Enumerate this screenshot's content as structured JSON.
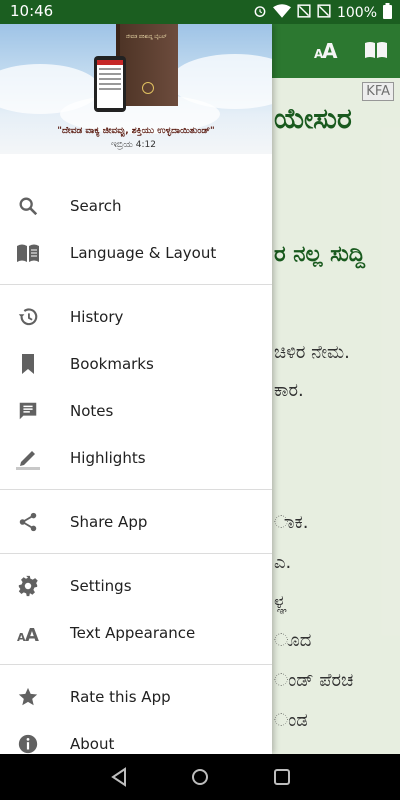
{
  "status_bar": {
    "time": "10:46",
    "battery": "100%"
  },
  "app": {
    "badge": "KFA",
    "title": "ಯೇಸುರ",
    "subtitle": "ರ ನಲ್ಲ ಸುದ್ದಿ",
    "lines": [
      "ಚಿಳಿರ ನೇಮ.",
      "ಕಾರ.",
      "ಾಕ.",
      "ಎ.",
      "ಳ್ಞ",
      "ೂದ",
      "ಂಡ್ ಪೆರಚ",
      "ಂಡ"
    ]
  },
  "drawer": {
    "header": {
      "quote": "\"ದೇವಡ ವಾಕ್ಯ ಜೀವವ್ಪು, ಶಕ್ತಿಯು ಉಳ್ಳದಾಯಿತುಂಡ್\"",
      "reference": "ಇಬ್ರಿಯ 4:12",
      "book_title": "ದೇವಡ ಪರಿಶುದ್ಧ ಬೈಬಲ್"
    },
    "groups": [
      [
        {
          "label": "Search",
          "icon": "search-icon"
        },
        {
          "label": "Language & Layout",
          "icon": "book-open-icon"
        }
      ],
      [
        {
          "label": "History",
          "icon": "history-icon"
        },
        {
          "label": "Bookmarks",
          "icon": "bookmark-icon"
        },
        {
          "label": "Notes",
          "icon": "note-icon"
        },
        {
          "label": "Highlights",
          "icon": "highlighter-icon"
        }
      ],
      [
        {
          "label": "Share App",
          "icon": "share-icon"
        }
      ],
      [
        {
          "label": "Settings",
          "icon": "gear-icon"
        },
        {
          "label": "Text Appearance",
          "icon": "text-size-icon"
        }
      ],
      [
        {
          "label": "Rate this App",
          "icon": "star-icon"
        },
        {
          "label": "About",
          "icon": "info-icon"
        }
      ]
    ]
  },
  "colors": {
    "toolbar": "#2e7d32",
    "status_bar": "#1b5e20",
    "accent_text": "#1b5e20",
    "drawer_icon": "#616161"
  }
}
